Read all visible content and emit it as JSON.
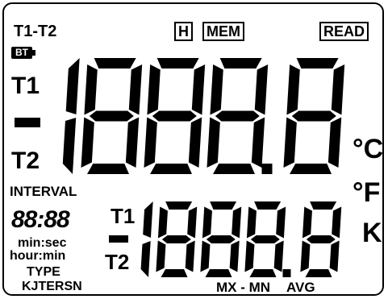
{
  "labels": {
    "mode_diff": "T1-T2",
    "hold": "H",
    "memory": "MEM",
    "read": "READ",
    "battery": "BT",
    "t1_main": "T1",
    "t2_main": "T2",
    "unit_c": "°C",
    "unit_f": "°F",
    "unit_k": "K",
    "interval": "INTERVAL",
    "interval_value": "88:88",
    "min_sec": "min:sec",
    "hour_min": "hour:min",
    "type_label": "TYPE",
    "type_codes": "KJTERSN",
    "t1_sub": "T1",
    "t2_sub": "T2",
    "max_min": "MX - MN",
    "avg": "AVG"
  },
  "main_display": "1888.8",
  "sub_display": "1888.8"
}
